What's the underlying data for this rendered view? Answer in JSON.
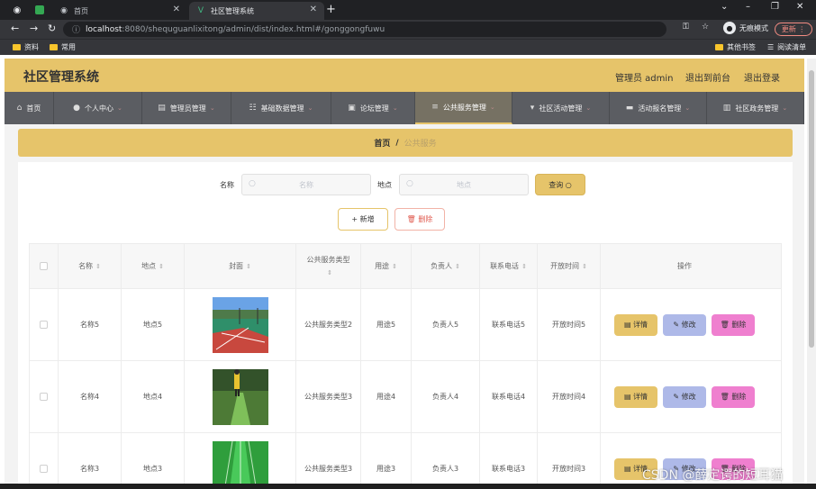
{
  "browser": {
    "tabs": [
      {
        "label": "首页",
        "active": false
      },
      {
        "label": "社区管理系统",
        "active": true
      }
    ],
    "url_host": "localhost",
    "url_rest": ":8080/shequguanlixitong/admin/dist/index.html#/gonggongfuwu",
    "incognito_label": "无痕模式",
    "update_label": "更新",
    "bookmarks": [
      {
        "label": "资料"
      },
      {
        "label": "常用"
      }
    ],
    "other_bookmarks": "其他书签",
    "reading_list": "阅读清单"
  },
  "header": {
    "title": "社区管理系统",
    "user_label": "管理员 admin",
    "front_label": "退出到前台",
    "logout_label": "退出登录"
  },
  "nav": {
    "items": [
      {
        "label": "首页",
        "icon": "home-icon"
      },
      {
        "label": "个人中心",
        "icon": "user-icon"
      },
      {
        "label": "管理员管理",
        "icon": "admin-icon"
      },
      {
        "label": "基础数据管理",
        "icon": "data-icon"
      },
      {
        "label": "论坛管理",
        "icon": "forum-icon"
      },
      {
        "label": "公共服务管理",
        "icon": "list-icon"
      },
      {
        "label": "社区活动管理",
        "icon": "activity-icon"
      },
      {
        "label": "活动报名管理",
        "icon": "signup-icon"
      },
      {
        "label": "社区政务管理",
        "icon": "gov-icon"
      }
    ]
  },
  "breadcrumb": {
    "home": "首页",
    "sep": "/",
    "current": "公共服务"
  },
  "search": {
    "name_label": "名称",
    "name_placeholder": "名称",
    "place_label": "地点",
    "place_placeholder": "地点",
    "query_label": "查询"
  },
  "actions": {
    "add_label": "新增",
    "delete_label": "删除"
  },
  "table": {
    "columns": [
      "名称",
      "地点",
      "封面",
      "公共服务类型",
      "用途",
      "负责人",
      "联系电话",
      "开放时间",
      "操作"
    ],
    "rows": [
      {
        "name": "名称5",
        "place": "地点5",
        "type": "公共服务类型2",
        "use": "用途5",
        "owner": "负责人5",
        "phone": "联系电话5",
        "open": "开放时间5"
      },
      {
        "name": "名称4",
        "place": "地点4",
        "type": "公共服务类型3",
        "use": "用途4",
        "owner": "负责人4",
        "phone": "联系电话4",
        "open": "开放时间4"
      },
      {
        "name": "名称3",
        "place": "地点3",
        "type": "公共服务类型3",
        "use": "用途3",
        "owner": "负责人3",
        "phone": "联系电话3",
        "open": "开放时间3"
      }
    ],
    "row_actions": {
      "detail": "详情",
      "edit": "修改",
      "delete": "删除"
    }
  },
  "watermark": "CSDN @薛定谔的短耳猫",
  "colors": {
    "accent": "#e6c46a",
    "nav": "#5b5d62",
    "edit": "#aeb9e8",
    "delete": "#ef7fcf"
  }
}
